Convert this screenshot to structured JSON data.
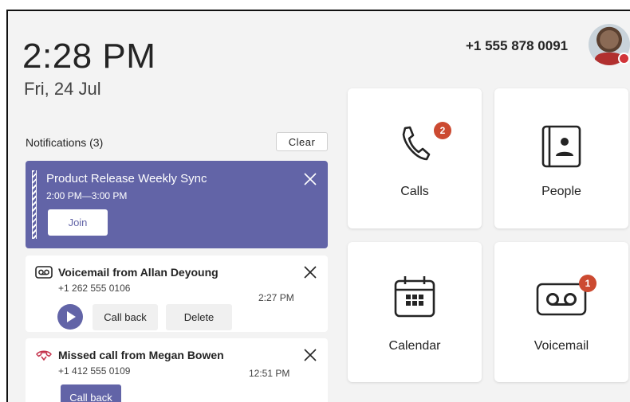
{
  "header": {
    "time": "2:28 PM",
    "date": "Fri, 24 Jul",
    "phone_number": "+1 555 878 0091"
  },
  "notifications": {
    "title": "Notifications (3)",
    "clear_label": "Clear",
    "meeting": {
      "title": "Product Release Weekly Sync",
      "time": "2:00 PM—3:00 PM",
      "join_label": "Join"
    },
    "voicemail": {
      "title": "Voicemail from Allan Deyoung",
      "phone": "+1 262 555 0106",
      "time": "2:27 PM",
      "call_back_label": "Call back",
      "delete_label": "Delete"
    },
    "missed_call": {
      "title": "Missed call from Megan Bowen",
      "phone": "+1 412 555 0109",
      "time": "12:51 PM",
      "call_back_label": "Call back"
    }
  },
  "tiles": {
    "calls": {
      "label": "Calls",
      "badge": "2",
      "icon": "phone-icon"
    },
    "people": {
      "label": "People",
      "icon": "contact-card-icon"
    },
    "calendar": {
      "label": "Calendar",
      "icon": "calendar-icon"
    },
    "voicemail": {
      "label": "Voicemail",
      "badge": "1",
      "icon": "voicemail-icon"
    }
  },
  "colors": {
    "accent": "#6264a7",
    "badge": "#cc4a31",
    "presence_busy": "#d13438",
    "missed_call": "#c4314b"
  }
}
